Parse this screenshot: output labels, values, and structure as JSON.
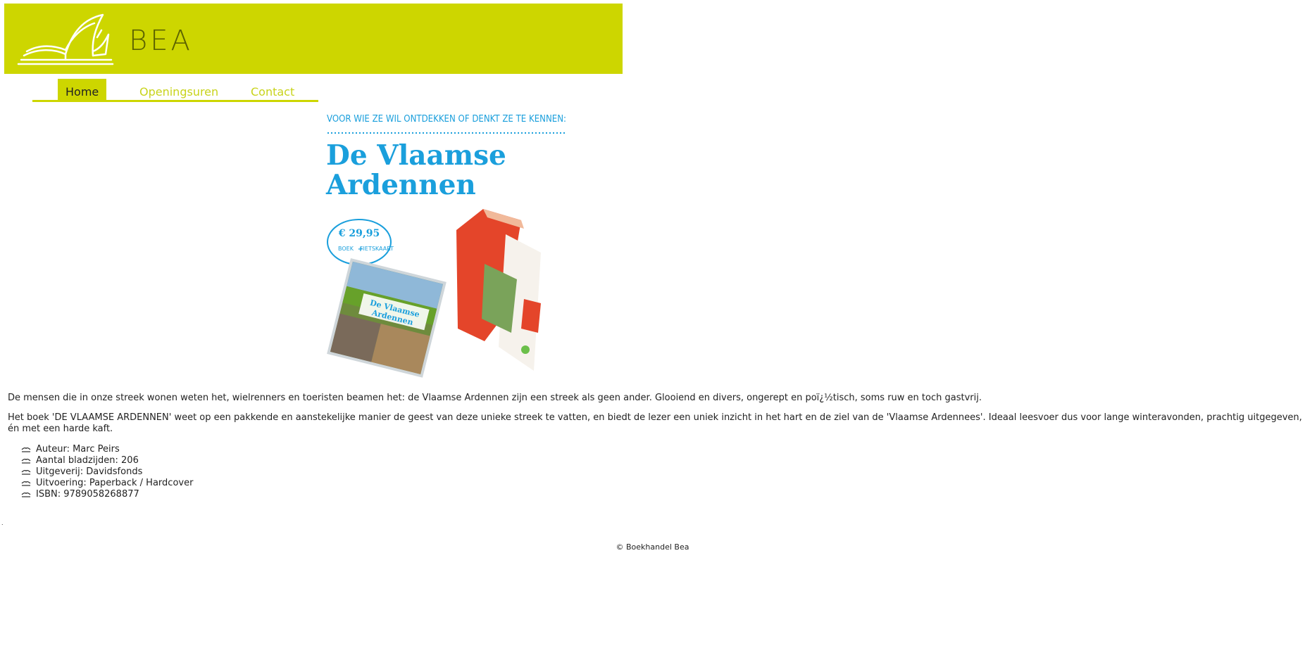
{
  "header": {
    "brand": "BEA",
    "logo": "open-book-logo",
    "background": "#cdd600"
  },
  "nav": {
    "items": [
      {
        "label": "Home",
        "active": true
      },
      {
        "label": "Openingsuren",
        "active": false
      },
      {
        "label": "Contact",
        "active": false
      }
    ],
    "accent": "#cdd600",
    "link_color": "#c8d31a"
  },
  "promo": {
    "tagline": "VOOR WIE ZE WIL ONTDEKKEN OF DENKT ZE TE KENNEN:",
    "title_line_1": "De Vlaamse",
    "title_line_2": "Ardennen",
    "price": "€ 29,95",
    "price_sub_1": "BOEK",
    "price_sub_2": "FIETSKAART",
    "book_title_1": "De Vlaamse",
    "book_title_2": "Ardennen",
    "accent": "#1a9fdc",
    "map_color": "#e4452a"
  },
  "content": {
    "intro_1": "De mensen die in onze streek wonen weten het, wielrenners en toeristen beamen het: de Vlaamse Ardennen zijn een streek als geen ander. Glooiend en divers, ongerept en poï¿½tisch, soms ruw en toch gastvrij.",
    "intro_2": "Het boek 'DE VLAAMSE ARDENNEN' weet op een pakkende en aanstekelijke manier de geest van deze unieke streek te vatten, en biedt de lezer een uniek inzicht in het hart en de ziel van de 'Vlaamse Ardennees'. Ideaal leesvoer dus voor lange winteravonden, prachtig uitgegeven, én met een harde kaft.",
    "specs": [
      "Auteur: Marc Peirs",
      "Aantal bladzijden: 206",
      "Uitgeverij: Davidsfonds",
      "Uitvoering: Paperback / Hardcover",
      "ISBN: 9789058268877"
    ],
    "bullet_icon": "book-bullet-icon"
  },
  "stray_mark": ".",
  "footer": {
    "copyright": "© Boekhandel Bea"
  }
}
